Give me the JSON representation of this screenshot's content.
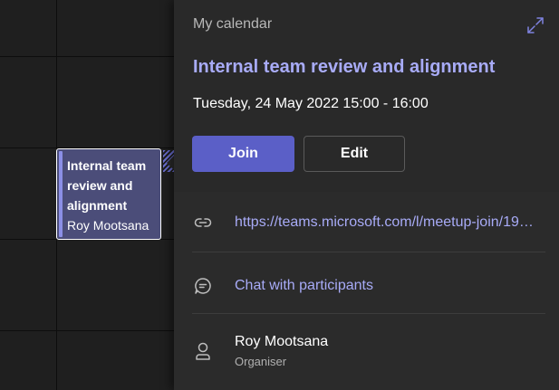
{
  "calendar_event": {
    "title": "Internal team review and alignment",
    "organiser": "Roy Mootsana"
  },
  "popover": {
    "calendar_name": "My calendar",
    "meeting_title": "Internal team review and alignment",
    "datetime": "Tuesday, 24 May 2022 15:00 - 16:00",
    "join_label": "Join",
    "edit_label": "Edit",
    "meeting_link": "https://teams.microsoft.com/l/meetup-join/19%3ameeting",
    "chat_label": "Chat with participants",
    "organiser": {
      "name": "Roy Mootsana",
      "role": "Organiser"
    }
  },
  "colors": {
    "accent": "#5b5fc7",
    "accent_text": "#a8abf7",
    "panel_bg": "#2b2b2b",
    "grid_bg": "#1f1f1f"
  },
  "icons": {
    "expand": "expand-icon",
    "link": "link-icon",
    "chat": "chat-icon",
    "person": "person-icon"
  }
}
